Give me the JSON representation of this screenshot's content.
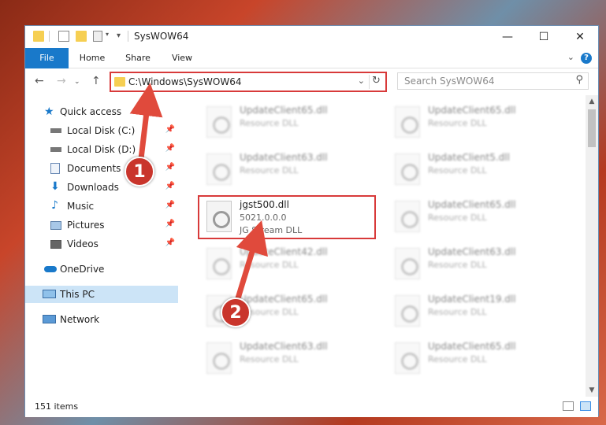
{
  "window": {
    "title": "SysWOW64",
    "controls": {
      "minimize": "—",
      "maximize": "☐",
      "close": "✕"
    }
  },
  "ribbon": {
    "tabs": [
      "File",
      "Home",
      "Share",
      "View"
    ],
    "help": "?"
  },
  "navigation": {
    "address": "C:\\Windows\\SysWOW64",
    "search_placeholder": "Search SysWOW64"
  },
  "sidebar": {
    "items": [
      {
        "label": "Quick access",
        "icon": "star-icon"
      },
      {
        "label": "Local Disk (C:)",
        "icon": "drive-icon",
        "pinned": true
      },
      {
        "label": "Local Disk (D:)",
        "icon": "drive-icon",
        "pinned": true
      },
      {
        "label": "Documents",
        "icon": "documents-icon",
        "pinned": true
      },
      {
        "label": "Downloads",
        "icon": "download-icon",
        "pinned": true
      },
      {
        "label": "Music",
        "icon": "music-icon",
        "pinned": true
      },
      {
        "label": "Pictures",
        "icon": "pictures-icon",
        "pinned": true
      },
      {
        "label": "Videos",
        "icon": "videos-icon",
        "pinned": true
      },
      {
        "label": "OneDrive",
        "icon": "cloud-icon"
      },
      {
        "label": "This PC",
        "icon": "computer-icon",
        "selected": true
      },
      {
        "label": "Network",
        "icon": "network-icon"
      }
    ]
  },
  "files": {
    "left": [
      {
        "name": "UpdateClient65.dll",
        "type": "Resource DLL"
      },
      {
        "name": "UpdateClient63.dll",
        "type": "Resource DLL"
      },
      {
        "name": "jgst500.dll",
        "version": "5021.0.0.0",
        "type": "JG Stream DLL",
        "highlighted": true
      },
      {
        "name": "UpdateClient42.dll",
        "type": "Resource DLL"
      },
      {
        "name": "UpdateClient65.dll",
        "type": "Resource DLL"
      },
      {
        "name": "UpdateClient63.dll",
        "type": "Resource DLL"
      }
    ],
    "right": [
      {
        "name": "UpdateClient65.dll",
        "type": "Resource DLL"
      },
      {
        "name": "UpdateClient5.dll",
        "type": "Resource DLL"
      },
      {
        "name": "UpdateClient65.dll",
        "type": "Resource DLL"
      },
      {
        "name": "UpdateClient63.dll",
        "type": "Resource DLL"
      },
      {
        "name": "UpdateClient19.dll",
        "type": "Resource DLL"
      },
      {
        "name": "UpdateClient65.dll",
        "type": "Resource DLL"
      }
    ]
  },
  "status": {
    "item_count": "151 items"
  },
  "annotations": {
    "step1": "1",
    "step2": "2"
  },
  "colors": {
    "accent": "#1979ca",
    "highlight": "#d83a3a",
    "badge": "#c9352c",
    "folder": "#f6cf52"
  }
}
